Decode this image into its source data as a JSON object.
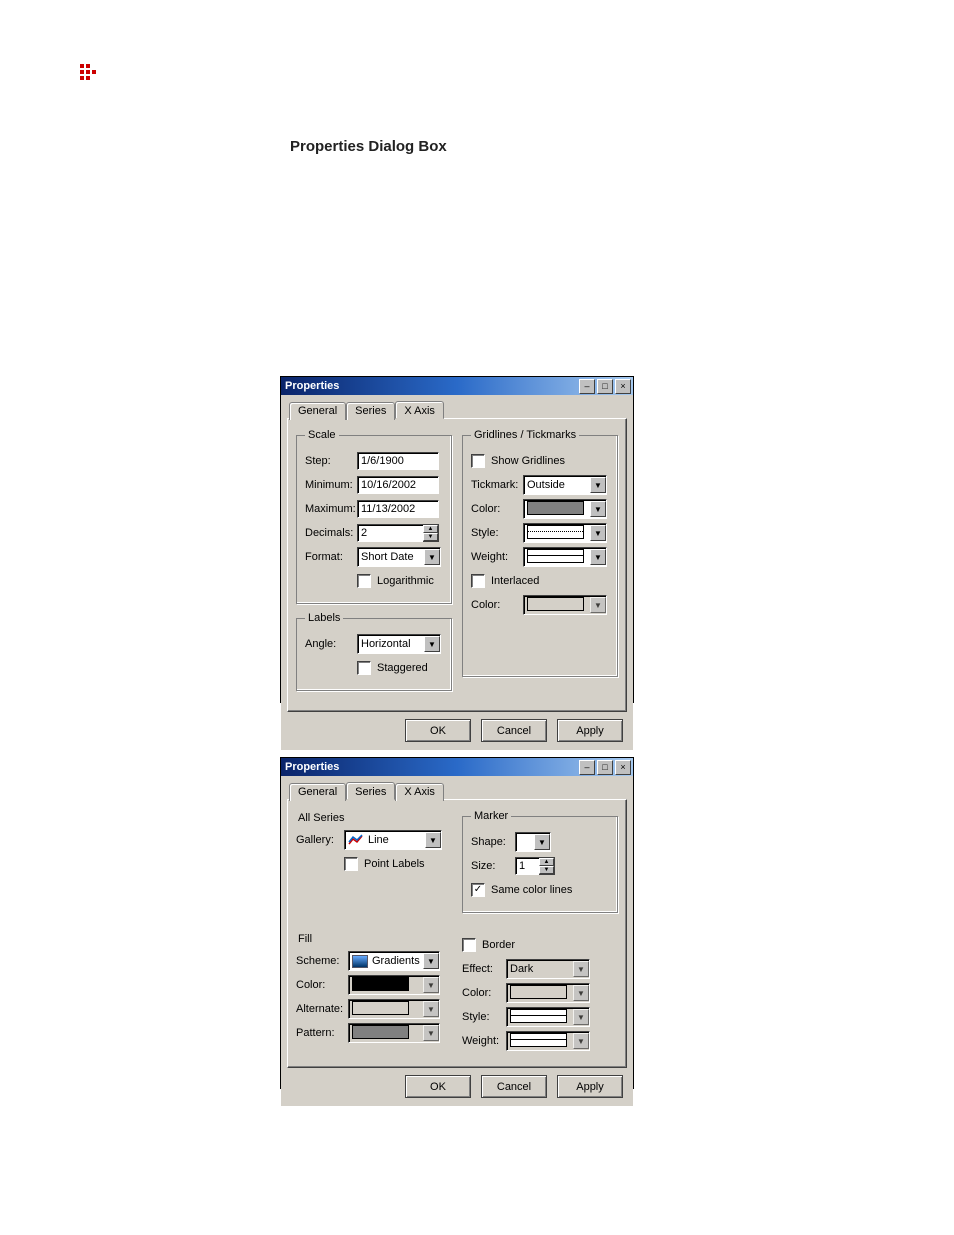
{
  "heading": "Properties Dialog Box",
  "dialog1": {
    "title": "Properties",
    "tabs": {
      "general": "General",
      "series": "Series",
      "xaxis": "X Axis"
    },
    "activeTab": "xaxis",
    "scale": {
      "legend": "Scale",
      "step_label": "Step:",
      "step_value": "1/6/1900",
      "min_label": "Minimum:",
      "min_value": "10/16/2002",
      "max_label": "Maximum:",
      "max_value": "11/13/2002",
      "decimals_label": "Decimals:",
      "decimals_value": "2",
      "format_label": "Format:",
      "format_value": "Short Date",
      "log_label": "Logarithmic"
    },
    "labels": {
      "legend": "Labels",
      "angle_label": "Angle:",
      "angle_value": "Horizontal",
      "staggered_label": "Staggered"
    },
    "grid": {
      "legend": "Gridlines / Tickmarks",
      "show_label": "Show Gridlines",
      "tick_label": "Tickmark:",
      "tick_value": "Outside",
      "color_label": "Color:",
      "style_label": "Style:",
      "weight_label": "Weight:",
      "interlaced_label": "Interlaced",
      "color2_label": "Color:"
    },
    "buttons": {
      "ok": "OK",
      "cancel": "Cancel",
      "apply": "Apply"
    }
  },
  "dialog2": {
    "title": "Properties",
    "tabs": {
      "general": "General",
      "series": "Series",
      "xaxis": "X Axis"
    },
    "activeTab": "series",
    "allseries": "All Series",
    "gallery_label": "Gallery:",
    "gallery_value": "Line",
    "pointlabels_label": "Point Labels",
    "marker": {
      "legend": "Marker",
      "shape_label": "Shape:",
      "size_label": "Size:",
      "size_value": "1",
      "samecolor_label": "Same color lines"
    },
    "fill": {
      "legend": "Fill",
      "scheme_label": "Scheme:",
      "scheme_value": "Gradients",
      "color_label": "Color:",
      "alternate_label": "Alternate:",
      "pattern_label": "Pattern:"
    },
    "border": {
      "legend_label": "Border",
      "effect_label": "Effect:",
      "effect_value": "Dark",
      "color_label": "Color:",
      "style_label": "Style:",
      "weight_label": "Weight:"
    },
    "buttons": {
      "ok": "OK",
      "cancel": "Cancel",
      "apply": "Apply"
    }
  }
}
